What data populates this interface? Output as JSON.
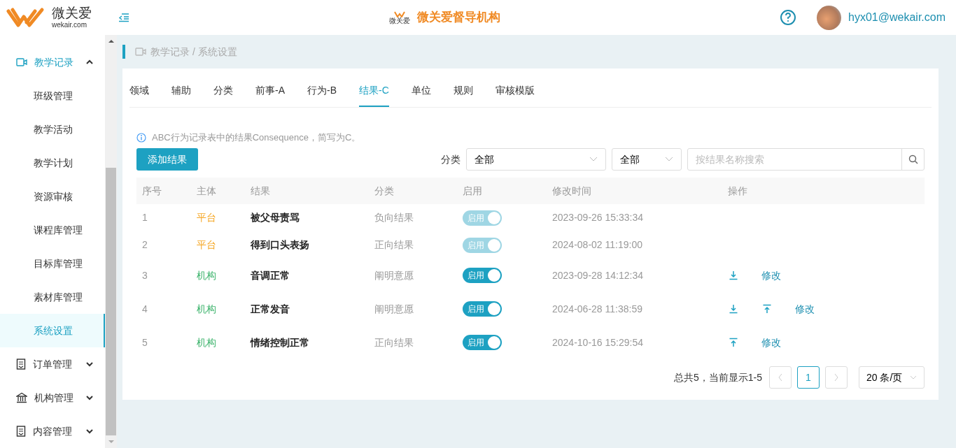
{
  "header": {
    "logo_text": "微关爱",
    "logo_domain": "wekair.com",
    "center_logo_text": "微关爱",
    "title": "微关爱督导机构",
    "user": "hyx01@wekair.com"
  },
  "sidebar": {
    "groups": [
      {
        "label": "教学记录",
        "expanded": true,
        "children": [
          {
            "label": "班级管理",
            "selected": false
          },
          {
            "label": "教学活动",
            "selected": false
          },
          {
            "label": "教学计划",
            "selected": false
          },
          {
            "label": "资源审核",
            "selected": false
          },
          {
            "label": "课程库管理",
            "selected": false
          },
          {
            "label": "目标库管理",
            "selected": false
          },
          {
            "label": "素材库管理",
            "selected": false
          },
          {
            "label": "系统设置",
            "selected": true
          }
        ]
      },
      {
        "label": "订单管理",
        "expanded": false
      },
      {
        "label": "机构管理",
        "expanded": false
      },
      {
        "label": "内容管理",
        "expanded": false
      }
    ]
  },
  "breadcrumb": "教学记录 / 系统设置",
  "tabs": [
    {
      "label": "领域",
      "selected": false
    },
    {
      "label": "辅助",
      "selected": false
    },
    {
      "label": "分类",
      "selected": false
    },
    {
      "label": "前事-A",
      "selected": false
    },
    {
      "label": "行为-B",
      "selected": false
    },
    {
      "label": "结果-C",
      "selected": true
    },
    {
      "label": "单位",
      "selected": false
    },
    {
      "label": "规则",
      "selected": false
    },
    {
      "label": "审核模版",
      "selected": false
    }
  ],
  "info": "ABC行为记录表中的结果Consequence，简写为C。",
  "add_button": "添加结果",
  "filter_label": "分类",
  "filter_1": "全部",
  "filter_2": "全部",
  "search": {
    "placeholder": "按结果名称搜索"
  },
  "table": {
    "columns": [
      "序号",
      "主体",
      "结果",
      "分类",
      "启用",
      "修改时间",
      "操作"
    ],
    "rows": [
      {
        "index": "1",
        "owner": "平台",
        "color": "#f5a623",
        "name": "被父母责骂",
        "category": "负向结果",
        "toggle": {
          "label": "启用",
          "on": true,
          "disabled": true
        },
        "time": "2023-09-26 15:33:34",
        "actions": []
      },
      {
        "index": "2",
        "owner": "平台",
        "color": "#f5a623",
        "name": "得到口头表扬",
        "category": "正向结果",
        "toggle": {
          "label": "启用",
          "on": true,
          "disabled": true
        },
        "time": "2024-08-02 11:19:00",
        "actions": []
      },
      {
        "index": "3",
        "owner": "机构",
        "color": "#3bb36b",
        "name": "音调正常",
        "category": "阐明意愿",
        "toggle": {
          "label": "启用",
          "on": true,
          "disabled": false
        },
        "time": "2023-09-28 14:12:34",
        "actions": [
          {
            "kind": "down"
          },
          {
            "kind": "edit",
            "label": "修改"
          }
        ]
      },
      {
        "index": "4",
        "owner": "机构",
        "color": "#3bb36b",
        "name": "正常发音",
        "category": "阐明意愿",
        "toggle": {
          "label": "启用",
          "on": true,
          "disabled": false
        },
        "time": "2024-06-28 11:38:59",
        "actions": [
          {
            "kind": "down"
          },
          {
            "kind": "top"
          },
          {
            "kind": "edit",
            "label": "修改"
          }
        ]
      },
      {
        "index": "5",
        "owner": "机构",
        "color": "#3bb36b",
        "name": "情绪控制正常",
        "category": "正向结果",
        "toggle": {
          "label": "启用",
          "on": true,
          "disabled": false
        },
        "time": "2024-10-16 15:29:54",
        "actions": [
          {
            "kind": "top"
          },
          {
            "kind": "edit",
            "label": "修改"
          }
        ]
      }
    ]
  },
  "pagination": {
    "summary": "总共5，当前显示1-5",
    "pages": [
      {
        "label": "1",
        "selected": true
      }
    ],
    "page_size": "20 条/页"
  }
}
